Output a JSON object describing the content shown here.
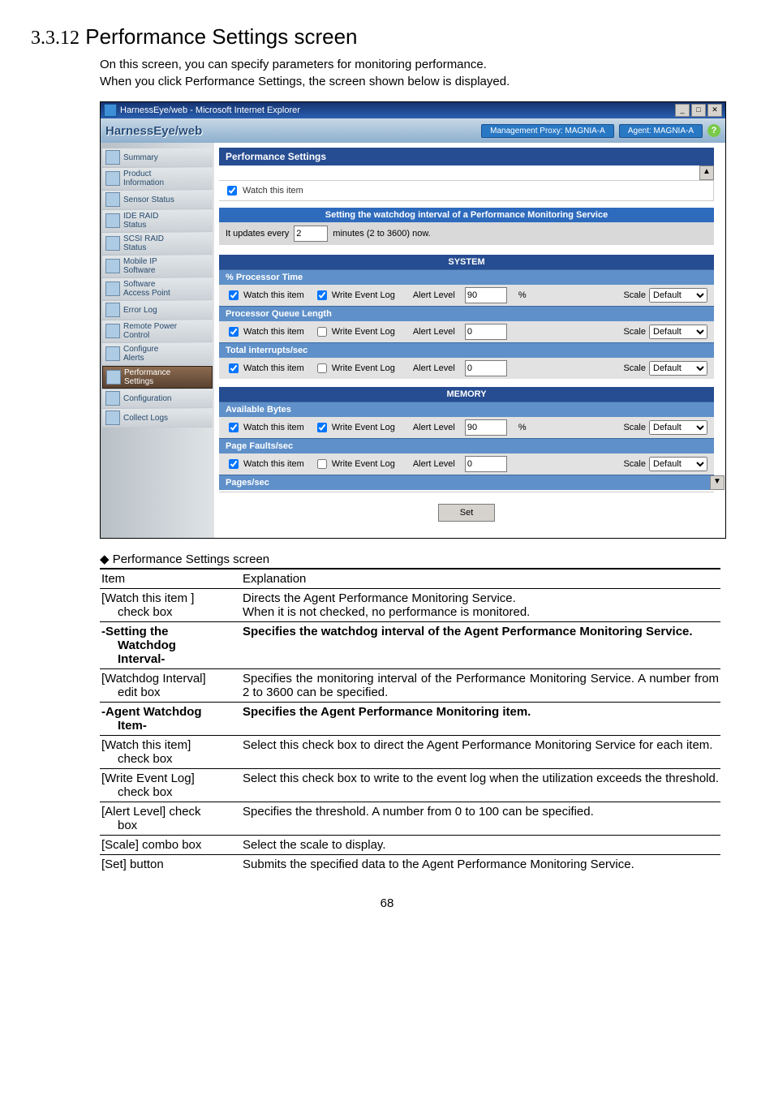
{
  "heading_number": "3.3.12",
  "heading_title": "Performance Settings screen",
  "intro_line1": "On this screen, you can specify parameters for monitoring performance.",
  "intro_line2": "When you click Performance Settings, the screen shown below is displayed.",
  "window": {
    "title": "HarnessEye/web - Microsoft Internet Explorer",
    "brand": "HarnessEye/web",
    "tag1": "Management Proxy: MAGNIA-A",
    "tag2": "Agent: MAGNIA-A",
    "help": "?"
  },
  "sidebar": {
    "items": [
      "Summary",
      "Product\nInformation",
      "Sensor Status",
      "IDE RAID\nStatus",
      "SCSI RAID\nStatus",
      "Mobile IP\nSoftware",
      "Software\nAccess Point",
      "Error Log",
      "Remote Power\nControl",
      "Configure\nAlerts",
      "Performance\nSettings",
      "Configuration",
      "Collect Logs"
    ],
    "active_index": 10
  },
  "panel": {
    "head": "Performance Settings",
    "watch_master": "Watch this item",
    "setting_band": "Setting the watchdog interval of a Performance Monitoring Service",
    "interval_prefix": "It updates every",
    "interval_value": "2",
    "interval_suffix": "minutes (2 to 3600) now.",
    "system_band": "SYSTEM",
    "memory_band": "MEMORY",
    "labels": {
      "watch": "Watch this item",
      "write": "Write Event Log",
      "alert": "Alert Level",
      "scale": "Scale",
      "default": "Default",
      "pct": "%"
    },
    "sections": [
      {
        "title": "% Processor Time",
        "watch": true,
        "write": true,
        "alert": "90",
        "pct": true
      },
      {
        "title": "Processor Queue Length",
        "watch": true,
        "write": false,
        "alert": "0",
        "pct": false
      },
      {
        "title": "Total interrupts/sec",
        "watch": true,
        "write": false,
        "alert": "0",
        "pct": false
      }
    ],
    "mem_sections": [
      {
        "title": "Available Bytes",
        "watch": true,
        "write": true,
        "alert": "90",
        "pct": true
      },
      {
        "title": "Page Faults/sec",
        "watch": true,
        "write": false,
        "alert": "0",
        "pct": false
      },
      {
        "title": "Pages/sec"
      }
    ],
    "set": "Set"
  },
  "caption": "◆ Performance Settings screen",
  "table": {
    "h_item": "Item",
    "h_exp": "Explanation",
    "rows": [
      {
        "item": "[Watch this item ]\n  check box",
        "exp": "Directs the Agent Performance Monitoring Service.\nWhen it is not checked, no performance is monitored."
      },
      {
        "item": "-Setting the\n  Watchdog\n  Interval-",
        "exp": "Specifies the watchdog interval of the Agent Performance Monitoring Service.",
        "bold": true
      },
      {
        "item": "[Watchdog Interval]\n  edit box",
        "exp": "Specifies the monitoring interval of the Performance Monitoring Service. A number from 2 to 3600 can be specified."
      },
      {
        "item": "-Agent Watchdog\n  Item-",
        "exp": "Specifies the Agent Performance Monitoring item.",
        "bold": true
      },
      {
        "item": "[Watch this item]\n  check box",
        "exp": "Select this check box to direct the Agent Performance Monitoring Service for each item."
      },
      {
        "item": "[Write Event Log]\n  check box",
        "exp": "Select this check box to write to the event log when the utilization exceeds the threshold."
      },
      {
        "item": "[Alert Level] check\n  box",
        "exp": "Specifies the threshold.    A number from 0 to 100 can be specified."
      },
      {
        "item": "[Scale] combo box",
        "exp": "Select the scale to display."
      },
      {
        "item": "[Set] button",
        "exp": "Submits the specified data to the Agent Performance Monitoring Service."
      }
    ]
  },
  "page_number": "68"
}
